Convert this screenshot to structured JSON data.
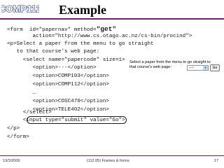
{
  "logo": {
    "text": "COMP112"
  },
  "slide": {
    "title": "Example"
  },
  "code": {
    "line1": "<form  id=\"papernav\" method=",
    "line1_big": "\"get\"",
    "line2": "        action=\"http://www.cs.otago.ac.nz/cs-bin/procind\">",
    "line3": "<p>Select a paper from the menu to go straight",
    "line4": "   to that course's web page:",
    "line5": "     <select name=\"papercode\" size=1>",
    "line6": "        <option>---</option>",
    "line7": "        <option>COMP103</option>",
    "line8": "        <option>COMP112</option>",
    "line9": "        …",
    "line10": "        <option>COSC470</option>",
    "line11": "        <option>TELE402</option>",
    "line12": "     </select>",
    "line13": "     <input type=\"submit\" value=\"Go\">",
    "line14": "</p>",
    "line15": "</form>"
  },
  "screenshot": {
    "text_line1": "Select a paper from the menu to go straight to",
    "text_line2": "that course's web page:",
    "select_value": "----",
    "select_arrow": "▼",
    "go_label": "Go"
  },
  "footer": {
    "date": "13/3/2006",
    "course": "(112.05) Frames & forms",
    "page": "17"
  },
  "colors": {
    "accent": "#6a1f6a",
    "logo_fill": "#3a4f8c"
  }
}
